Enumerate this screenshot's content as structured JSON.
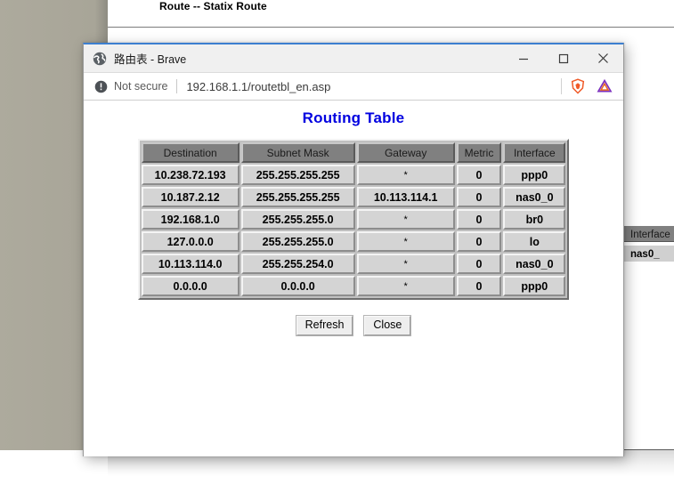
{
  "background_page": {
    "heading": "Route -- Statix Route",
    "partial_table": {
      "header": "Interface",
      "value": "nas0_"
    }
  },
  "browser": {
    "window_title": "路由表 - Brave",
    "favicon_name": "globe-icon",
    "controls": {
      "minimize": "minimize",
      "maximize": "maximize",
      "close": "close"
    },
    "address_bar": {
      "security_label": "Not secure",
      "security_icon": "warning-circle-icon",
      "url": "192.168.1.1/routetbl_en.asp",
      "extension_icons": [
        "brave-shield-icon",
        "triangle-extension-icon"
      ]
    },
    "accent_color": "#3c7fd0"
  },
  "page": {
    "title": "Routing Table",
    "title_color": "#0000e0",
    "table": {
      "columns": [
        "Destination",
        "Subnet Mask",
        "Gateway",
        "Metric",
        "Interface"
      ],
      "rows": [
        [
          "10.238.72.193",
          "255.255.255.255",
          "*",
          "0",
          "ppp0"
        ],
        [
          "10.187.2.12",
          "255.255.255.255",
          "10.113.114.1",
          "0",
          "nas0_0"
        ],
        [
          "192.168.1.0",
          "255.255.255.0",
          "*",
          "0",
          "br0"
        ],
        [
          "127.0.0.0",
          "255.255.255.0",
          "*",
          "0",
          "lo"
        ],
        [
          "10.113.114.0",
          "255.255.254.0",
          "*",
          "0",
          "nas0_0"
        ],
        [
          "0.0.0.0",
          "0.0.0.0",
          "*",
          "0",
          "ppp0"
        ]
      ]
    },
    "buttons": {
      "refresh": "Refresh",
      "close": "Close"
    }
  }
}
